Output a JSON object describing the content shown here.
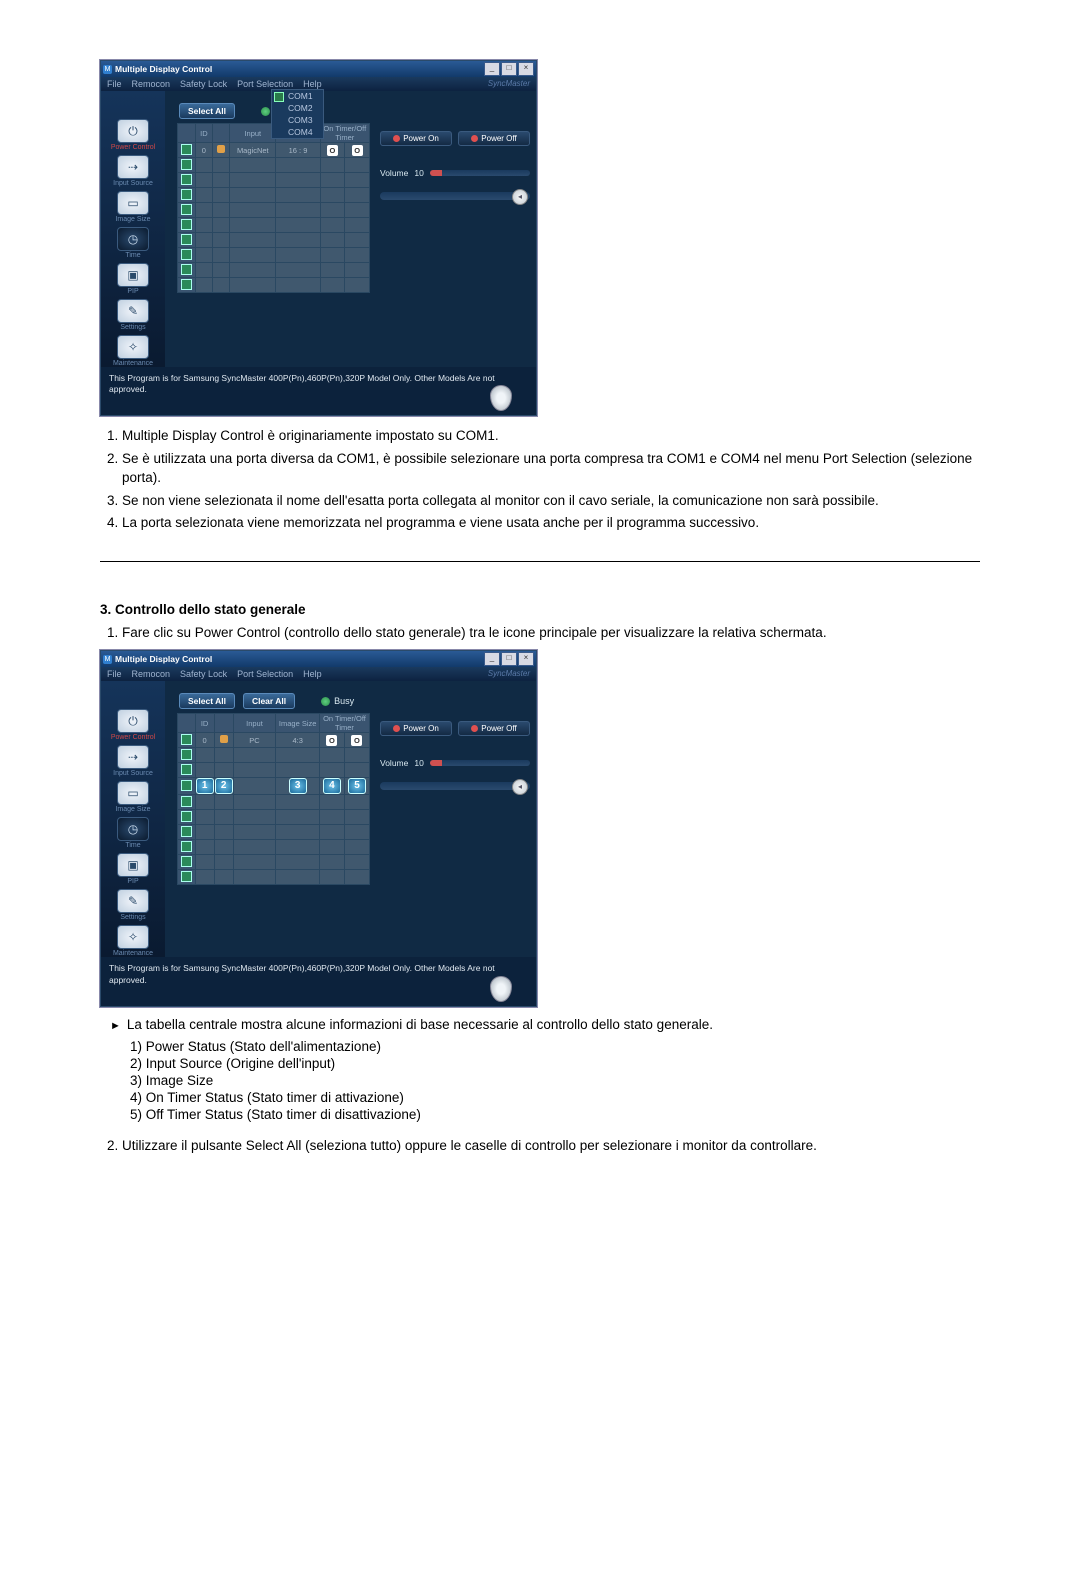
{
  "app": {
    "title": "Multiple Display Control",
    "menus": [
      "File",
      "Remocon",
      "Safety Lock",
      "Port Selection",
      "Help"
    ],
    "brand": "SyncMaster",
    "port_options": [
      "COM1",
      "COM2",
      "COM3",
      "COM4"
    ],
    "sidebar": [
      {
        "label": "Power Control",
        "glyph": "⏻"
      },
      {
        "label": "Input Source",
        "glyph": "⇢"
      },
      {
        "label": "Image Size",
        "glyph": "▭"
      },
      {
        "label": "Time",
        "glyph": "◷"
      },
      {
        "label": "PIP",
        "glyph": "▣"
      },
      {
        "label": "Settings",
        "glyph": "✎"
      },
      {
        "label": "Maintenance",
        "glyph": "✧"
      }
    ],
    "select_all": "Select All",
    "clear_all": "Clear All",
    "busy": "Busy",
    "cols": {
      "id": "ID",
      "input": "Input",
      "imgsize": "Image Size",
      "ontimer": "On Timer/Off Timer"
    },
    "row1": {
      "id": "0",
      "input_a": "MagicNet",
      "input_b": "PC",
      "size_a": "16 : 9",
      "size_b": "4:3",
      "on": "O",
      "off": "O"
    },
    "power_on": "Power On",
    "power_off": "Power Off",
    "volume_label": "Volume",
    "volume_value": "10",
    "footer": "This Program is for Samsung SyncMaster 400P(Pn),460P(Pn),320P  Model Only. Other Models Are not approved."
  },
  "callouts": {
    "c1": "1",
    "c2": "2",
    "c3": "3",
    "c4": "4",
    "c5": "5"
  },
  "sec1_list": [
    "Multiple Display Control è originariamente impostato su COM1.",
    "Se è utilizzata una porta diversa da COM1, è possibile selezionare una porta compresa tra COM1 e COM4 nel menu Port Selection (selezione porta).",
    "Se non viene selezionata il nome dell'esatta porta collegata al monitor con il cavo seriale, la comunicazione non sarà possibile.",
    "La porta selezionata viene memorizzata nel programma e viene usata anche per il programma successivo."
  ],
  "sec2": {
    "title": "3. Controllo dello stato generale",
    "item1": "Fare clic su Power Control (controllo dello stato generale) tra le icone principale per visualizzare la relativa schermata.",
    "bullet": "La tabella centrale mostra alcune informazioni di base necessarie al controllo dello stato generale.",
    "enum": [
      "1) Power Status (Stato dell'alimentazione)",
      "2) Input Source (Origine dell'input)",
      "3) Image Size",
      "4) On Timer Status (Stato timer di attivazione)",
      "5) Off Timer Status (Stato timer di disattivazione)"
    ],
    "item2": "Utilizzare il pulsante Select All (seleziona tutto) oppure le caselle di controllo per selezionare i monitor da controllare."
  }
}
